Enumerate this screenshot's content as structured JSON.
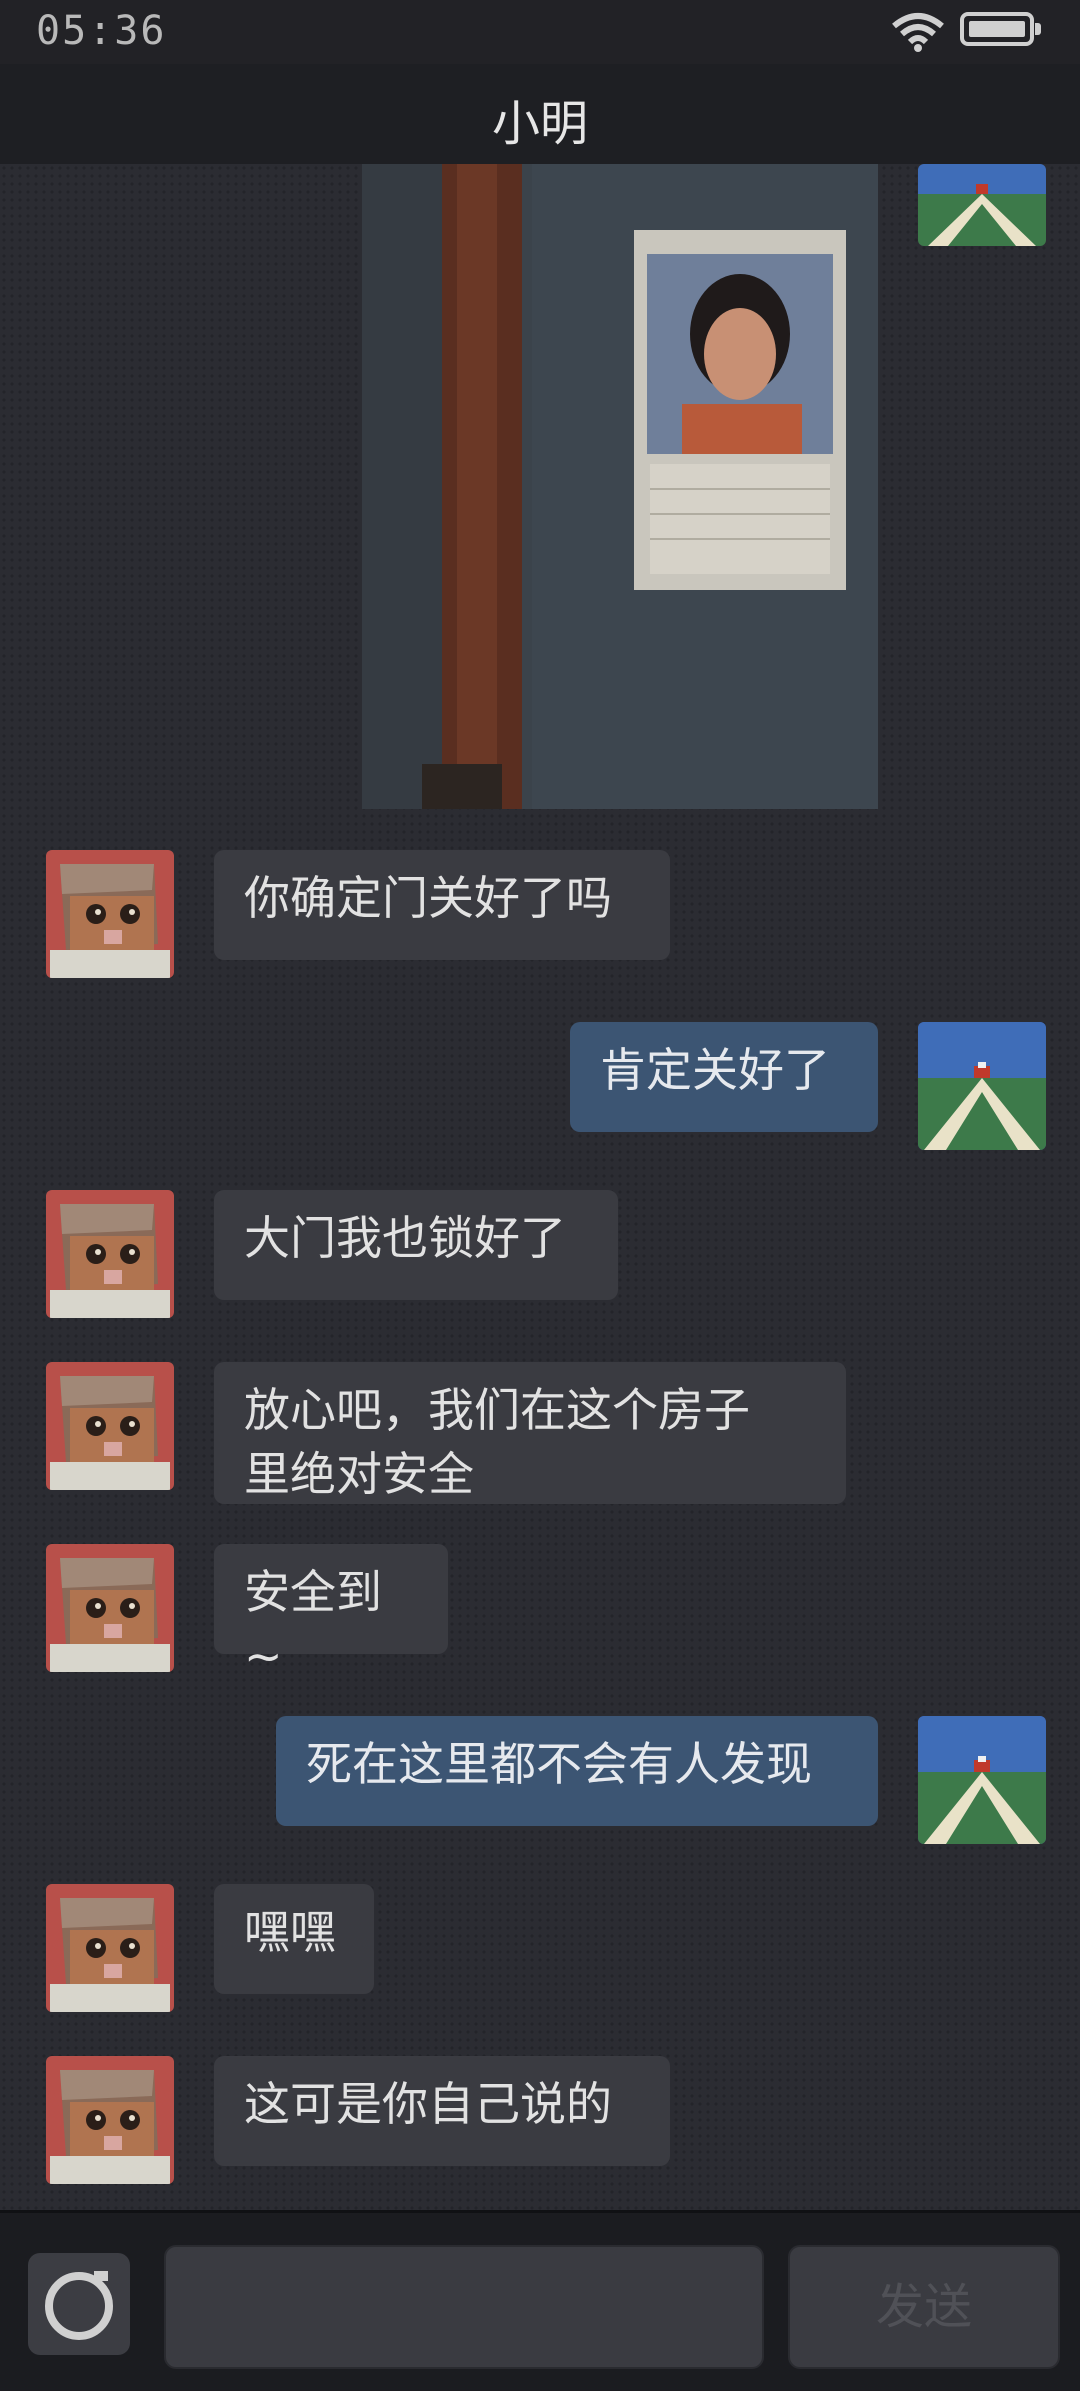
{
  "status": {
    "time": "05:36"
  },
  "header": {
    "title": "小明"
  },
  "messages": [
    {
      "from": "other",
      "text": "你确定门关好了吗"
    },
    {
      "from": "me",
      "text": "肯定关好了"
    },
    {
      "from": "other",
      "text": "大门我也锁好了"
    },
    {
      "from": "other",
      "text": "放心吧，我们在这个房子\n里绝对安全"
    },
    {
      "from": "other",
      "text": "安全到~"
    },
    {
      "from": "me",
      "text": "死在这里都不会有人发现"
    },
    {
      "from": "other",
      "text": "嘿嘿"
    },
    {
      "from": "other",
      "text": "这可是你自己说的"
    }
  ],
  "input": {
    "value": "",
    "send_label": "发送"
  },
  "icons": {
    "wifi": "wifi-icon",
    "battery": "battery-icon",
    "camera": "camera-icon"
  },
  "colors": {
    "incoming_bubble": "#3a3b41",
    "outgoing_bubble": "#3c5573",
    "background": "#2b2c32"
  }
}
